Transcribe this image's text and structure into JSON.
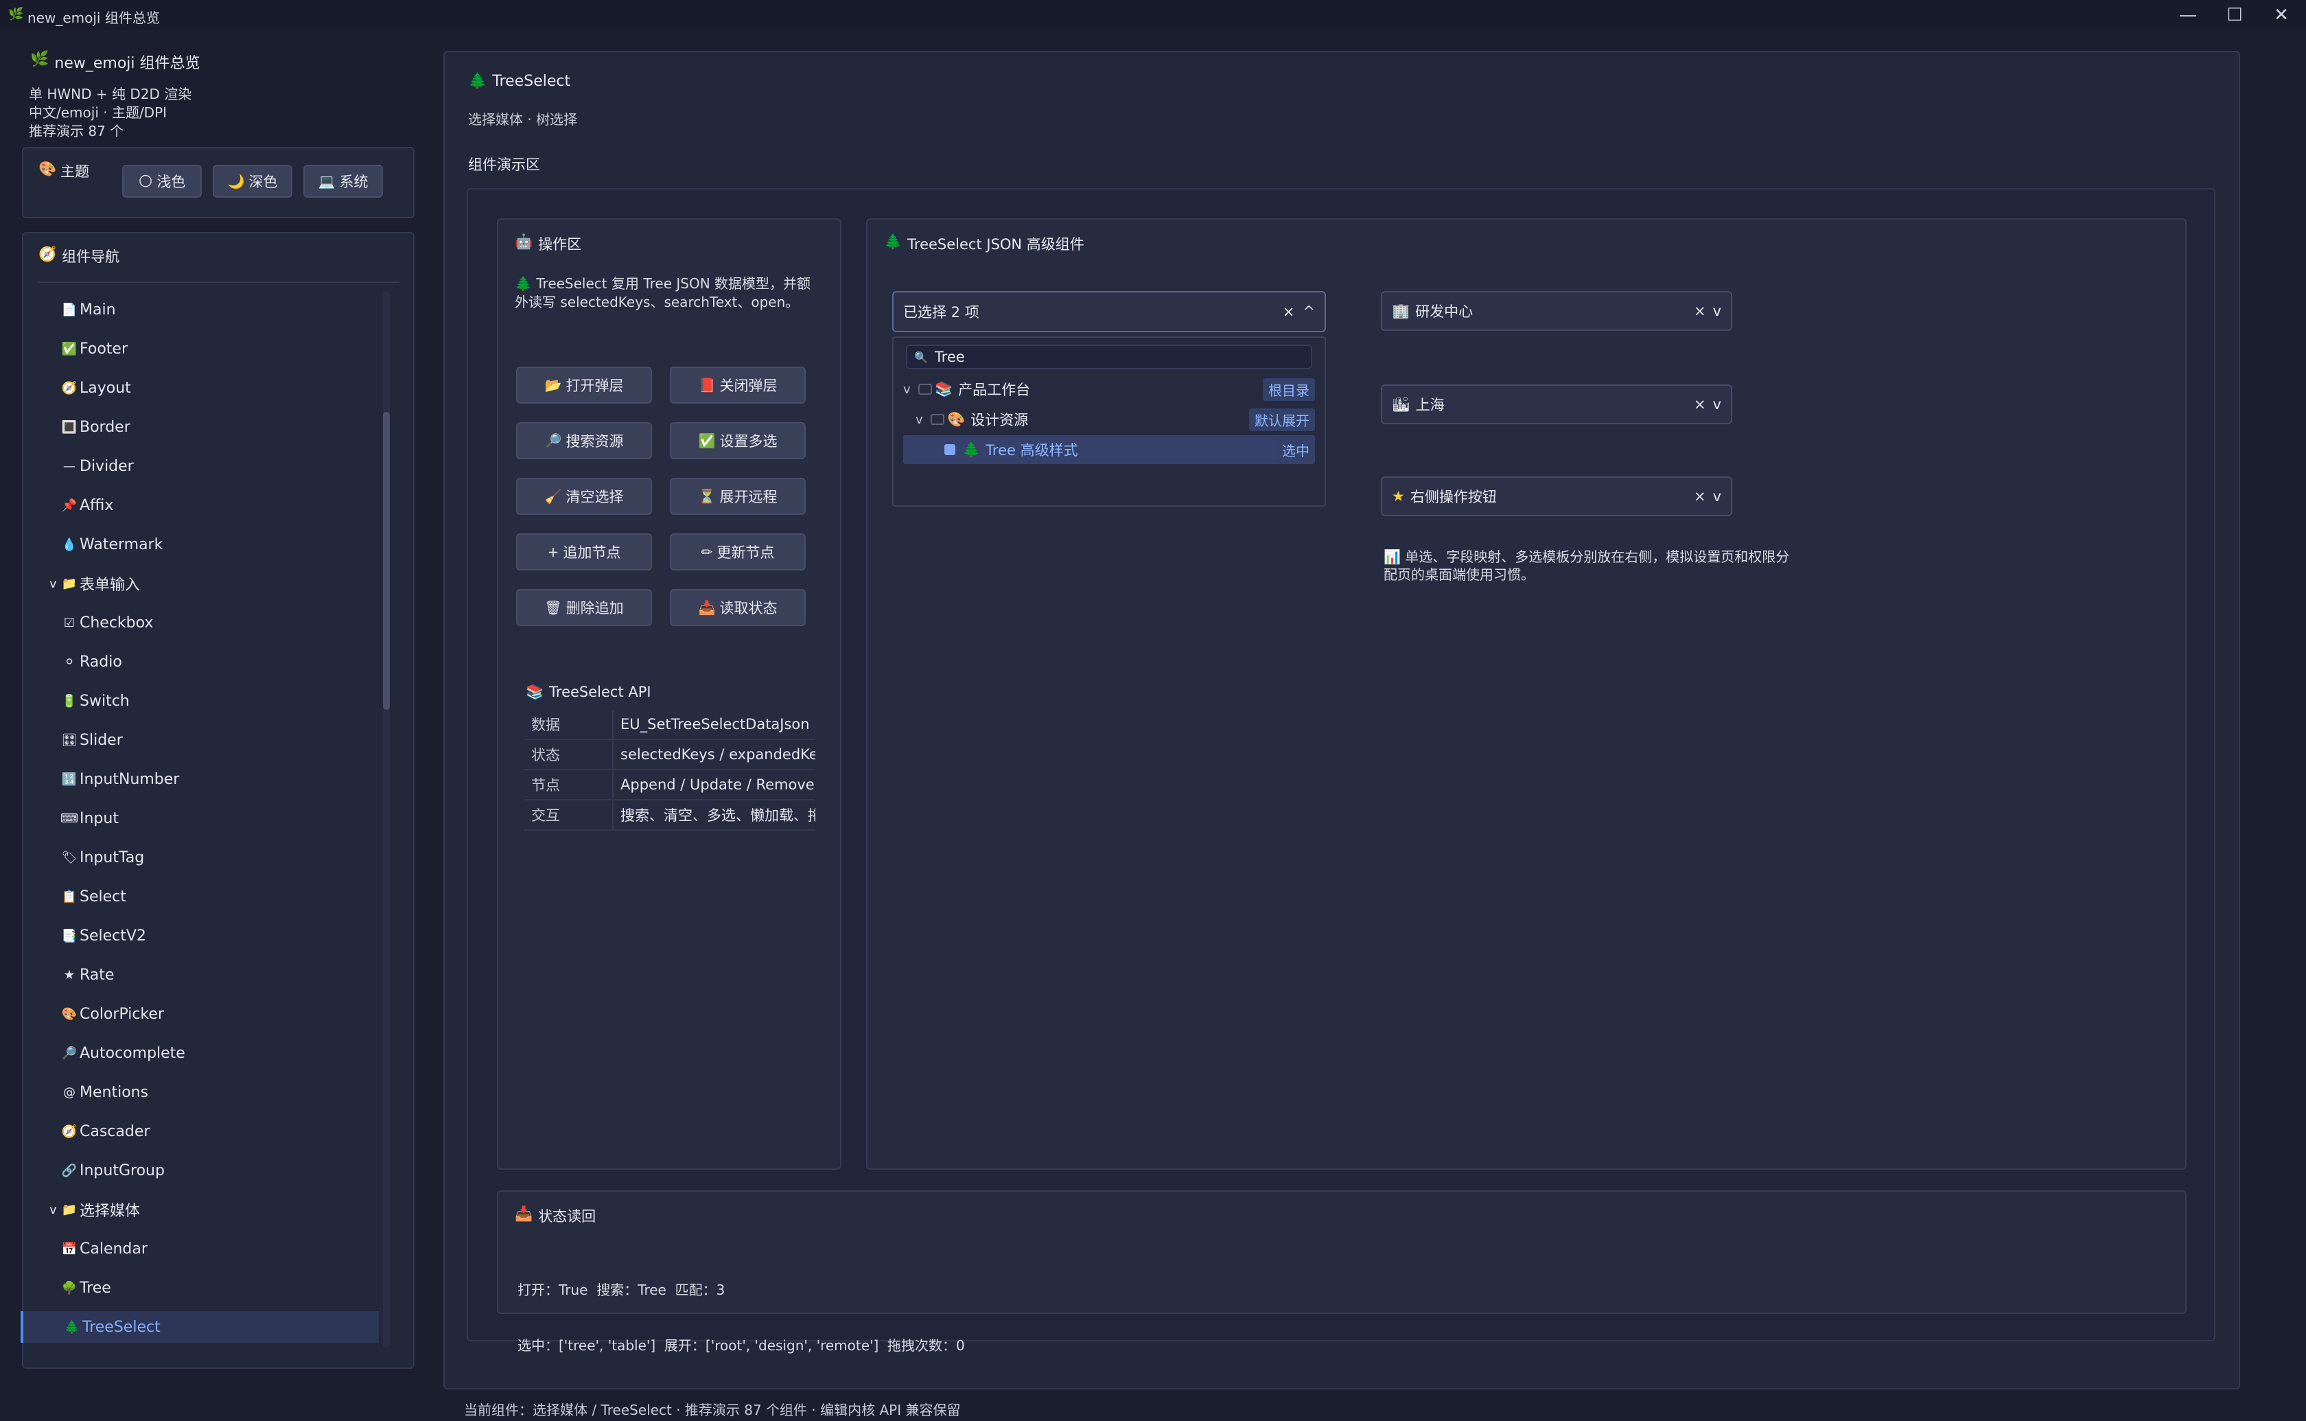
{
  "window": {
    "title": "new_emoji 组件总览",
    "minimize": "—",
    "maximize": "☐",
    "close": "✕"
  },
  "sidebar": {
    "app_name": "new_emoji 组件总览",
    "info_lines": [
      "单 HWND + 纯 D2D 渲染",
      "中文/emoji · 主题/DPI",
      "推荐演示 87 个"
    ],
    "theme": {
      "title": "主题",
      "options": [
        "浅色",
        "深色",
        "系统"
      ]
    },
    "nav_title": "组件导航",
    "nav_items": [
      {
        "label": "Main",
        "icon": "📄"
      },
      {
        "label": "Footer",
        "icon": "✅"
      },
      {
        "label": "Layout",
        "icon": "🧭"
      },
      {
        "label": "Border",
        "icon": "🔳"
      },
      {
        "label": "Divider",
        "icon": "—"
      },
      {
        "label": "Affix",
        "icon": "📌"
      },
      {
        "label": "Watermark",
        "icon": "💧"
      },
      {
        "label": "表单输入",
        "icon": "📁",
        "group": true,
        "prefix": "v"
      },
      {
        "label": "Checkbox",
        "icon": "☑"
      },
      {
        "label": "Radio",
        "icon": "⚪"
      },
      {
        "label": "Switch",
        "icon": "🔋"
      },
      {
        "label": "Slider",
        "icon": "🎛"
      },
      {
        "label": "InputNumber",
        "icon": "🔢"
      },
      {
        "label": "Input",
        "icon": "⌨"
      },
      {
        "label": "InputTag",
        "icon": "🏷"
      },
      {
        "label": "Select",
        "icon": "📋"
      },
      {
        "label": "SelectV2",
        "icon": "📑"
      },
      {
        "label": "Rate",
        "icon": "★"
      },
      {
        "label": "ColorPicker",
        "icon": "🎨"
      },
      {
        "label": "Autocomplete",
        "icon": "🔎"
      },
      {
        "label": "Mentions",
        "icon": "@"
      },
      {
        "label": "Cascader",
        "icon": "🧭"
      },
      {
        "label": "InputGroup",
        "icon": "🔗"
      },
      {
        "label": "选择媒体",
        "icon": "📁",
        "group": true,
        "prefix": "v"
      },
      {
        "label": "Calendar",
        "icon": "📅"
      },
      {
        "label": "Tree",
        "icon": "🌳"
      },
      {
        "label": "TreeSelect",
        "icon": "🌲",
        "active": true
      }
    ]
  },
  "main": {
    "title": "TreeSelect",
    "subtitle": "选择媒体 · 树选择",
    "demo_area": "组件演示区",
    "ops": {
      "title": "操作区",
      "desc_line1": "TreeSelect 复用 Tree JSON 数据模型，并额",
      "desc_line2": "外读写 selectedKeys、searchText、open。",
      "buttons": [
        {
          "label": "打开弹层",
          "icon": "📂"
        },
        {
          "label": "关闭弹层",
          "icon": "📕"
        },
        {
          "label": "搜索资源",
          "icon": "🔎"
        },
        {
          "label": "设置多选",
          "icon": "✅"
        },
        {
          "label": "清空选择",
          "icon": "🧹"
        },
        {
          "label": "展开远程",
          "icon": "⏳"
        },
        {
          "label": "追加节点",
          "icon": "+"
        },
        {
          "label": "更新节点",
          "icon": "✏"
        },
        {
          "label": "删除追加",
          "icon": "🗑"
        },
        {
          "label": "读取状态",
          "icon": "📥"
        }
      ],
      "api_title": "TreeSelect API",
      "api_rows": [
        {
          "k": "数据",
          "v": "EU_SetTreeSelectDataJson"
        },
        {
          "k": "状态",
          "v": "selectedKeys / expandedKeys"
        },
        {
          "k": "节点",
          "v": "Append / Update / Remove b"
        },
        {
          "k": "交互",
          "v": "搜索、清空、多选、懒加载、拖"
        }
      ]
    },
    "component": {
      "title": "TreeSelect JSON 高级组件",
      "select_value": "已选择 2 项",
      "clear": "×",
      "caret_up": "^",
      "caret_down": "v",
      "search_value": "Tree",
      "tree": [
        {
          "label": "产品工作台",
          "tag": "根目录",
          "expander": "v",
          "icon": "📚"
        },
        {
          "label": "设计资源",
          "tag": "默认展开",
          "expander": "v",
          "icon": "🎨"
        },
        {
          "label": "Tree 高级样式",
          "tag": "选中",
          "icon": "🌲"
        }
      ],
      "selects": [
        {
          "label": "研发中心",
          "icon": "🏢"
        },
        {
          "label": "上海",
          "icon": "🏙"
        },
        {
          "label": "右侧操作按钮",
          "icon": "★"
        }
      ],
      "note_line1": "单选、字段映射、多选模板分别放在右侧，模拟设置页和权限分",
      "note_line2": "配页的桌面端使用习惯。"
    },
    "status": {
      "title": "状态读回",
      "line1": "打开：True  搜索：Tree  匹配：3",
      "line2": "选中：['tree', 'table']  展开：['root', 'design', 'remote']  拖拽次数：0"
    },
    "footer": "当前组件：选择媒体 / TreeSelect · 推荐演示 87 个组件 · 编辑内核 API 兼容保留"
  },
  "colors": {
    "background": "#1b1e2e",
    "accent": "#4c8df6",
    "panel": "#23273a"
  }
}
